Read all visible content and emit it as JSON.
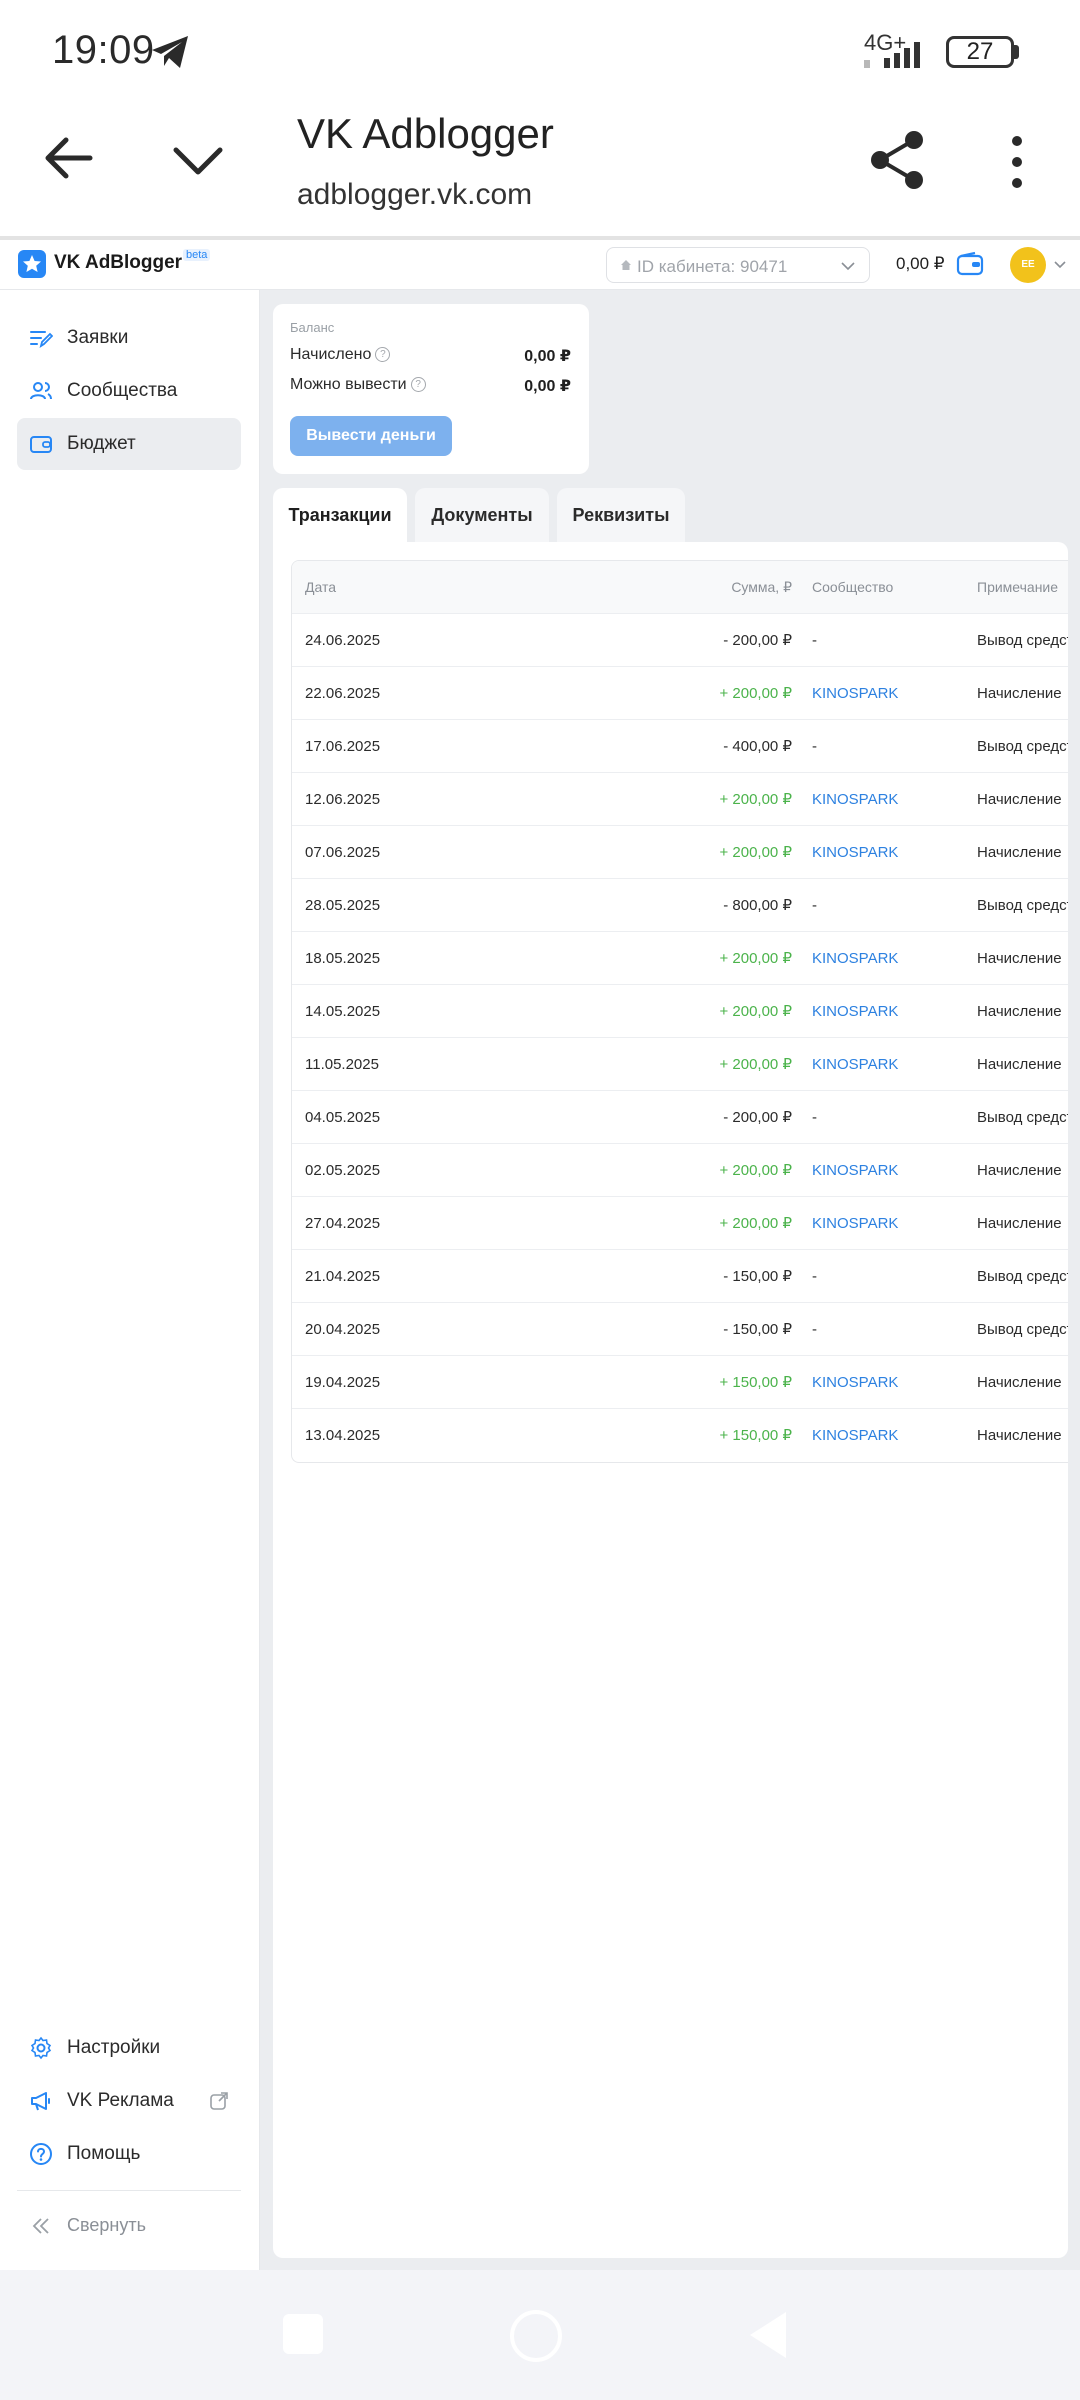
{
  "status_bar": {
    "time": "19:09",
    "network": "4G+",
    "battery": "27"
  },
  "browser": {
    "title": "VK Adblogger",
    "url": "adblogger.vk.com"
  },
  "app_header": {
    "name": "VK AdBlogger",
    "beta": "beta",
    "cabinet": "ID кабинета: 90471",
    "balance": "0,00 ₽",
    "avatar_initials": "EE"
  },
  "sidebar": {
    "items": [
      {
        "label": "Заявки",
        "icon": "edit-list-icon"
      },
      {
        "label": "Сообщества",
        "icon": "users-icon"
      },
      {
        "label": "Бюджет",
        "icon": "wallet-icon"
      }
    ],
    "bottom": [
      {
        "label": "Настройки",
        "icon": "gear-icon"
      },
      {
        "label": "VK Реклама",
        "icon": "megaphone-icon"
      },
      {
        "label": "Помощь",
        "icon": "help-icon"
      }
    ],
    "collapse": "Свернуть"
  },
  "balance_card": {
    "heading": "Баланс",
    "accrued_label": "Начислено",
    "accrued_value": "0,00 ₽",
    "withdrawable_label": "Можно вывести",
    "withdrawable_value": "0,00 ₽",
    "withdraw_button": "Вывести деньги"
  },
  "tabs": [
    "Транзакции",
    "Документы",
    "Реквизиты"
  ],
  "table": {
    "headers": {
      "date": "Дата",
      "sum": "Сумма, ₽",
      "community": "Сообщество",
      "note": "Примечание"
    },
    "rows": [
      {
        "date": "24.06.2025",
        "sum": "- 200,00 ₽",
        "community": "-",
        "note": "Вывод средств"
      },
      {
        "date": "22.06.2025",
        "sum": "+ 200,00 ₽",
        "community": "KINOSPARK",
        "note": "Начисление"
      },
      {
        "date": "17.06.2025",
        "sum": "- 400,00 ₽",
        "community": "-",
        "note": "Вывод средств"
      },
      {
        "date": "12.06.2025",
        "sum": "+ 200,00 ₽",
        "community": "KINOSPARK",
        "note": "Начисление"
      },
      {
        "date": "07.06.2025",
        "sum": "+ 200,00 ₽",
        "community": "KINOSPARK",
        "note": "Начисление"
      },
      {
        "date": "28.05.2025",
        "sum": "- 800,00 ₽",
        "community": "-",
        "note": "Вывод средств"
      },
      {
        "date": "18.05.2025",
        "sum": "+ 200,00 ₽",
        "community": "KINOSPARK",
        "note": "Начисление"
      },
      {
        "date": "14.05.2025",
        "sum": "+ 200,00 ₽",
        "community": "KINOSPARK",
        "note": "Начисление"
      },
      {
        "date": "11.05.2025",
        "sum": "+ 200,00 ₽",
        "community": "KINOSPARK",
        "note": "Начисление"
      },
      {
        "date": "04.05.2025",
        "sum": "- 200,00 ₽",
        "community": "-",
        "note": "Вывод средств"
      },
      {
        "date": "02.05.2025",
        "sum": "+ 200,00 ₽",
        "community": "KINOSPARK",
        "note": "Начисление"
      },
      {
        "date": "27.04.2025",
        "sum": "+ 200,00 ₽",
        "community": "KINOSPARK",
        "note": "Начисление"
      },
      {
        "date": "21.04.2025",
        "sum": "- 150,00 ₽",
        "community": "-",
        "note": "Вывод средств"
      },
      {
        "date": "20.04.2025",
        "sum": "- 150,00 ₽",
        "community": "-",
        "note": "Вывод средств"
      },
      {
        "date": "19.04.2025",
        "sum": "+ 150,00 ₽",
        "community": "KINOSPARK",
        "note": "Начисление"
      },
      {
        "date": "13.04.2025",
        "sum": "+ 150,00 ₽",
        "community": "KINOSPARK",
        "note": "Начисление"
      }
    ]
  },
  "colors": {
    "accent": "#2787f5",
    "positive": "#4bb34b",
    "link": "#2d81e0",
    "button_disabled": "#7db1ee",
    "avatar": "#f2c21b"
  }
}
